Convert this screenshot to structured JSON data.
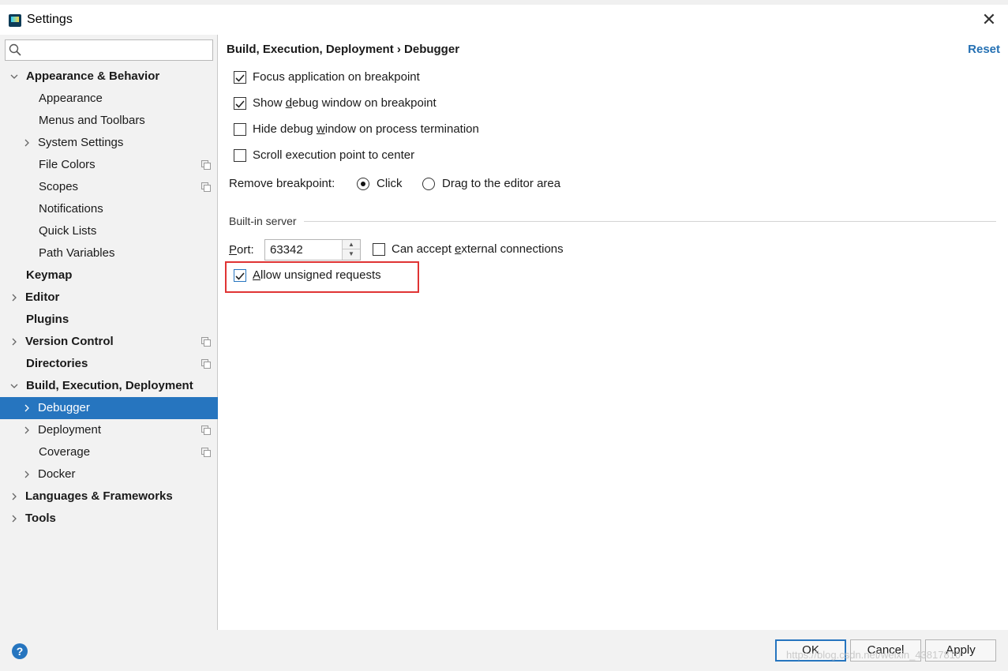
{
  "window": {
    "title": "Settings",
    "close_glyph": "✕"
  },
  "sidebar": {
    "search_placeholder": "",
    "items": [
      {
        "label": "Appearance & Behavior"
      },
      {
        "label": "Appearance"
      },
      {
        "label": "Menus and Toolbars"
      },
      {
        "label": "System Settings"
      },
      {
        "label": "File Colors"
      },
      {
        "label": "Scopes"
      },
      {
        "label": "Notifications"
      },
      {
        "label": "Quick Lists"
      },
      {
        "label": "Path Variables"
      },
      {
        "label": "Keymap"
      },
      {
        "label": "Editor"
      },
      {
        "label": "Plugins"
      },
      {
        "label": "Version Control"
      },
      {
        "label": "Directories"
      },
      {
        "label": "Build, Execution, Deployment"
      },
      {
        "label": "Debugger"
      },
      {
        "label": "Deployment"
      },
      {
        "label": "Coverage"
      },
      {
        "label": "Docker"
      },
      {
        "label": "Languages & Frameworks"
      },
      {
        "label": "Tools"
      }
    ]
  },
  "main": {
    "breadcrumb": "Build, Execution, Deployment › Debugger",
    "reset_label": "Reset",
    "options": [
      {
        "label": "Focus application on breakpoint",
        "checked": true
      },
      {
        "pre": "Show ",
        "mn": "d",
        "post": "ebug window on breakpoint",
        "checked": true
      },
      {
        "pre": "Hide debug ",
        "mn": "w",
        "post": "indow on process termination",
        "checked": false
      },
      {
        "label": "Scroll execution point to center",
        "checked": false
      }
    ],
    "remove_breakpoint": {
      "label": "Remove breakpoint:",
      "choices": [
        {
          "label": "Click",
          "selected": true
        },
        {
          "label": "Drag to the editor area",
          "selected": false
        }
      ]
    },
    "builtin_server": {
      "section_title": "Built-in server",
      "port_label_mn": "P",
      "port_label_rest": "ort:",
      "port_value": "63342",
      "external": {
        "pre": "Can accept ",
        "mn": "e",
        "post": "xternal connections",
        "checked": false
      },
      "unsigned": {
        "mn": "A",
        "post": "llow unsigned requests",
        "checked": true
      }
    }
  },
  "footer": {
    "help_glyph": "?",
    "ok_label": "OK",
    "cancel_label": "Cancel",
    "apply_label": "Apply",
    "watermark": "https://blog.csdn.net/weixin_43817810"
  },
  "colors": {
    "accent": "#2675bf",
    "highlight_box": "#e03434",
    "link": "#2470b3"
  }
}
